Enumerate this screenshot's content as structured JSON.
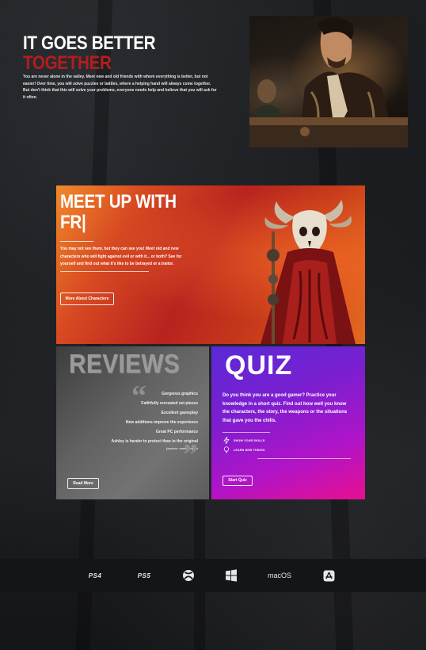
{
  "hero": {
    "title_line1": "IT GOES BETTER",
    "title_line2": "TOGETHER",
    "body": "You are never alone in the valley. Meet new and old friends with whom everything is better, but not easier! Over time, you will solve puzzles or battles, where a helping hand will always come together. But don't think that this will solve your problems, everyone needs help and believe that you will ask for it often."
  },
  "meet": {
    "title_line1": "MEET UP WITH",
    "title_line2": "FR|",
    "body": "You may not see them, but they can see you! Meet old and new characters who will fight against evil or with it... or both? See for yourself and find out what it's like to be betrayed or a traitor.",
    "button": "More About Characters"
  },
  "reviews": {
    "title": "REVIEWS",
    "items": [
      "Gorgeous graphics",
      "Faithfully recreated set pieces",
      "Excellent gameplay",
      "New additions improve the experience",
      "Great PC performance",
      "Ashley is harder to protect than in the original"
    ],
    "source": "(source: www.pcgam",
    "button": "Read More",
    "open_quote": "“",
    "close_quote": "”"
  },
  "quiz": {
    "title": "QUIZ",
    "body": "Do you think you are a good gamer? Practice your knowledge in a short quiz. Find out how well you know the characters, the story, the weapons or the situations that gave you the chills.",
    "items": [
      {
        "label": "SHOW YOUR SKILLS",
        "icon": "lightning-icon"
      },
      {
        "label": "LEARN NEW THINGS",
        "icon": "lightbulb-icon"
      }
    ],
    "button": "Start Quiz"
  },
  "platforms": [
    {
      "label": "PS4",
      "icon": "ps4-logo"
    },
    {
      "label": "PS5",
      "icon": "ps5-logo"
    },
    {
      "label": "",
      "icon": "xbox-icon"
    },
    {
      "label": "",
      "icon": "windows-icon"
    },
    {
      "label": "macOS",
      "icon": "macos-logo"
    },
    {
      "label": "",
      "icon": "app-store-icon"
    }
  ],
  "colors": {
    "accent_red": "#b51d1d",
    "meet_gradient": [
      "#f08a2a",
      "#b8231f"
    ],
    "quiz_gradient": [
      "#5a2ad6",
      "#e80f8f"
    ],
    "reviews_gray": "#616161"
  }
}
